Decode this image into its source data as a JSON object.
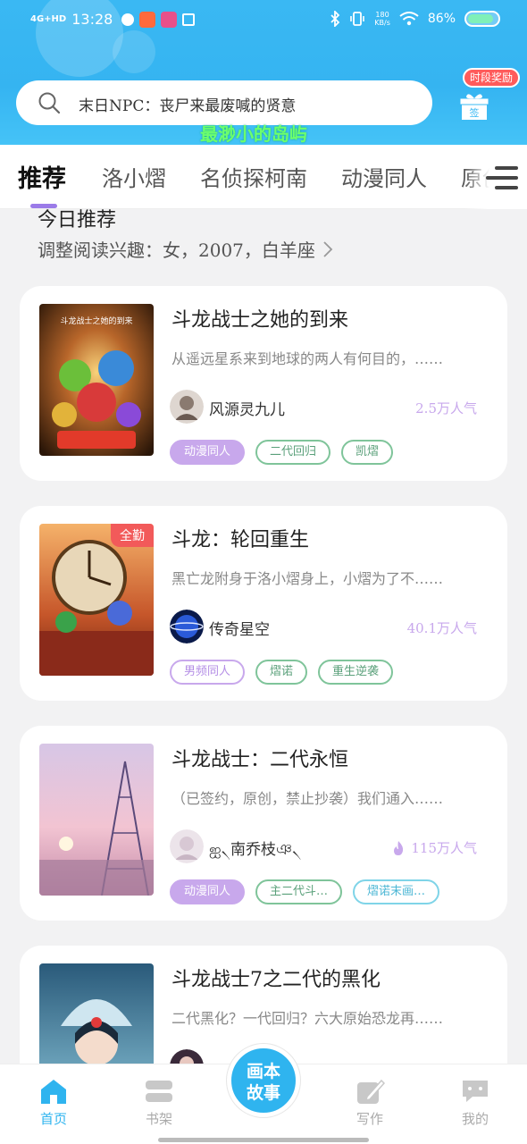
{
  "status_bar": {
    "network": "4G+HD",
    "time": "13:28",
    "net_speed_top": "180",
    "net_speed_bottom": "KB/s",
    "battery": "86%",
    "battery_level": 0.86
  },
  "search": {
    "text": "末日NPC：丧尸来最废喊的贤意",
    "overlay_text": "最渺小的岛屿",
    "signin_badge": "时段奖励",
    "signin_label": "签"
  },
  "tabs": [
    {
      "label": "推荐"
    },
    {
      "label": "洛小熠"
    },
    {
      "label": "名侦探柯南"
    },
    {
      "label": "动漫同人"
    },
    {
      "label": "原创"
    }
  ],
  "section": {
    "title": "今日推荐",
    "interest": "调整阅读兴趣：女，2007，白羊座"
  },
  "books": [
    {
      "title": "斗龙战士之她的到来",
      "desc": "从遥远星系来到地球的两人有何目的，……",
      "author": "风源灵九儿",
      "popularity": "2.5万人气",
      "cover_label": "",
      "cover_caption": "斗龙战士之她的到来",
      "tags": [
        {
          "label": "动漫同人",
          "style": "purple-fill"
        },
        {
          "label": "二代回归",
          "style": "green"
        },
        {
          "label": "凯熠",
          "style": "green"
        }
      ]
    },
    {
      "title": "斗龙：轮回重生",
      "desc": "黑亡龙附身于洛小熠身上，小熠为了不……",
      "author": "传奇星空",
      "popularity": "40.1万人气",
      "cover_label": "全勤",
      "tags": [
        {
          "label": "男频同人",
          "style": "purple-outline"
        },
        {
          "label": "熠诺",
          "style": "green"
        },
        {
          "label": "重生逆袭",
          "style": "green"
        }
      ]
    },
    {
      "title": "斗龙战士：二代永恒",
      "desc": "（已签约，原创，禁止抄袭）我们通入……",
      "author": "ஐ৲南乔枝ঞ৲",
      "popularity": "115万人气",
      "cover_label": "",
      "tags": [
        {
          "label": "动漫同人",
          "style": "purple-fill"
        },
        {
          "label": "主二代斗…",
          "style": "green"
        },
        {
          "label": "熠诺末画…",
          "style": "cyan"
        }
      ]
    },
    {
      "title": "斗龙战士7之二代的黑化",
      "desc": "二代黑化？一代回归？六大原始恐龙再……",
      "author": "",
      "popularity": "",
      "cover_label": "",
      "tags": []
    }
  ],
  "bottom_nav": {
    "home": "首页",
    "shelf": "书架",
    "center_line1": "画本",
    "center_line2": "故事",
    "write": "写作",
    "mine": "我的"
  },
  "colors": {
    "header_blue": "#3ab8f3",
    "accent_purple": "#c8a8ec",
    "tab_underline": "#9b7be8",
    "nav_active": "#2fb4ef",
    "tag_green": "#7fc49a",
    "badge_red": "#f25a5a"
  }
}
